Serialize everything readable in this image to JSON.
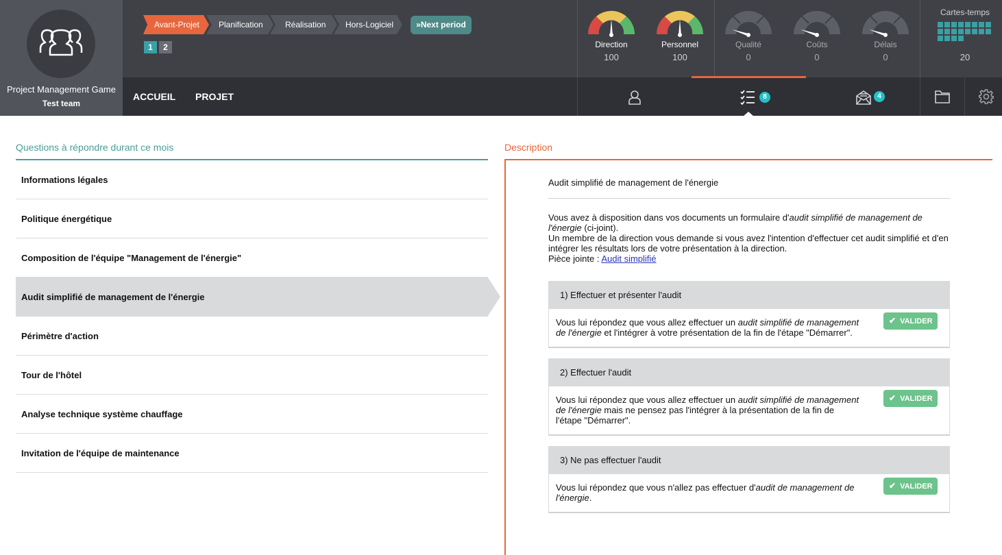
{
  "brand": {
    "app_name": "Project Management Game",
    "team_name": "Test team"
  },
  "nav": {
    "home": "ACCUEIL",
    "project": "PROJET"
  },
  "phases": [
    "Avant-Projet",
    "Planification",
    "Réalisation",
    "Hors-Logiciel"
  ],
  "next_period": "Next period",
  "pages": [
    "1",
    "2"
  ],
  "gauges": [
    {
      "label": "Direction",
      "value": "100",
      "active": true
    },
    {
      "label": "Personnel",
      "value": "100",
      "active": true
    },
    {
      "label": "Qualité",
      "value": "0",
      "active": false
    },
    {
      "label": "Coûts",
      "value": "0",
      "active": false
    },
    {
      "label": "Délais",
      "value": "0",
      "active": false
    }
  ],
  "cards": {
    "title": "Cartes-temps",
    "value": "20"
  },
  "toolbar": {
    "tasks_badge": "8",
    "mail_badge": "4"
  },
  "left": {
    "title": "Questions à répondre durant ce mois",
    "questions": [
      "Informations légales",
      "Politique énergétique",
      "Composition de l'équipe \"Management de l'énergie\"",
      "Audit simplifié de management de l'énergie",
      "Périmètre d'action",
      "Tour de l'hôtel",
      "Analyse technique système chauffage",
      "Invitation de l'équipe de maintenance"
    ]
  },
  "right": {
    "title": "Description",
    "heading": "Audit simplifié de management de l'énergie",
    "body": {
      "p1_a": "Vous avez à disposition dans vos documents un formulaire d'",
      "p1_em": "audit simplifié de management de l'énergie",
      "p1_b": " (ci-joint).",
      "p2": "Un membre de la direction vous demande si vous avez l'intention d'effectuer cet audit simplifié et d'en intégrer les résultats lors de votre présentation à la direction.",
      "attachment_label": "Pièce jointe : ",
      "attachment_link": "Audit simplifié"
    },
    "options": [
      {
        "title": "1) Effectuer et présenter l'audit",
        "text_a": "Vous lui répondez que vous allez effectuer un ",
        "text_em": "audit simplifié de management de l'énergie",
        "text_b": " et l'intégrer à votre présentation de la fin de l'étape \"Démarrer\"."
      },
      {
        "title": "2) Effectuer l'audit",
        "text_a": "Vous lui répondez que vous allez effectuer un ",
        "text_em": "audit simplifié de management de l'énergie",
        "text_b": " mais ne pensez pas l'intégrer à la présentation de la fin de l'étape \"Démarrer\"."
      },
      {
        "title": "3) Ne pas effectuer l'audit",
        "text_a": "Vous lui répondez que vous n'allez pas effectuer d'",
        "text_em": "audit de management de l'énergie",
        "text_b": "."
      }
    ],
    "validate_label": "VALIDER"
  },
  "colors": {
    "accent": "#e8663d",
    "teal": "#4a9d98",
    "validate": "#6cc38b",
    "badge": "#22c1c8"
  }
}
